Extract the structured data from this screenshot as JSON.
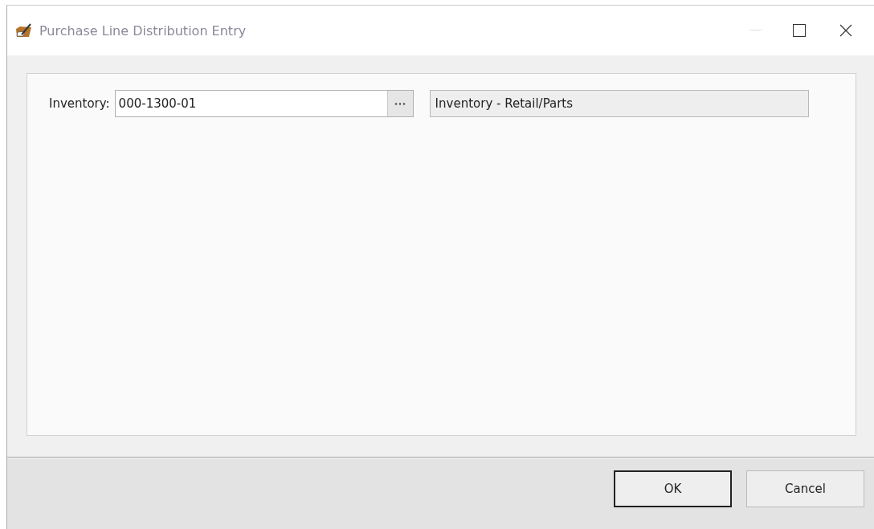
{
  "window": {
    "title": "Purchase Line Distribution Entry",
    "active": false
  },
  "field": {
    "label": "Inventory:",
    "value": "000-1300-01",
    "description": "Inventory - Retail/Parts"
  },
  "buttons": [
    {
      "label": "OK",
      "default": true
    },
    {
      "label": "Cancel",
      "default": false
    }
  ]
}
